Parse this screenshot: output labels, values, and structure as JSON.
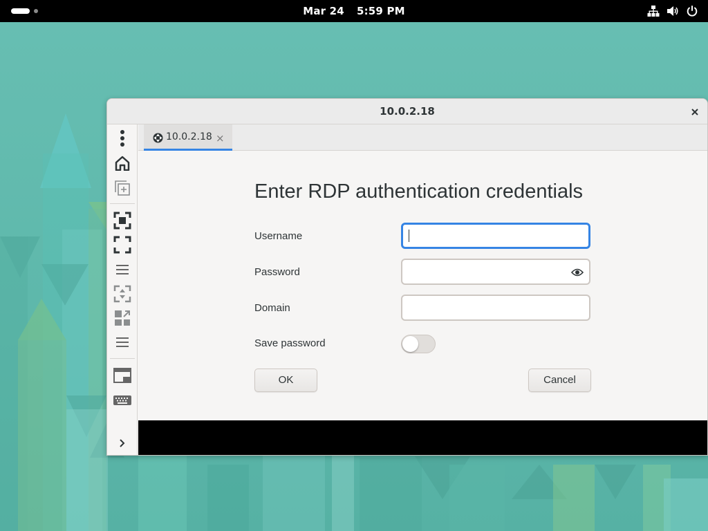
{
  "topbar": {
    "date": "Mar 24",
    "time": "5:59 PM",
    "tray_icons": [
      "network-icon",
      "volume-icon",
      "power-icon"
    ]
  },
  "window": {
    "title": "10.0.2.18",
    "tab": {
      "label": "10.0.2.18",
      "icon": "rdp-protocol-icon"
    },
    "sidebar_icons": [
      "menu-dots-icon",
      "home-icon",
      "duplicate-icon",
      "scale-icon",
      "fullscreen-icon",
      "hamburger-icon",
      "dynamic-resolution-icon",
      "fit-window-icon",
      "hamburger-icon",
      "multi-monitor-icon",
      "keyboard-icon",
      "expand-chevron-icon"
    ]
  },
  "dialog": {
    "heading": "Enter RDP authentication credentials",
    "username_label": "Username",
    "username_value": "",
    "password_label": "Password",
    "password_value": "",
    "domain_label": "Domain",
    "domain_value": "",
    "save_password_label": "Save password",
    "save_password_on": false,
    "ok_label": "OK",
    "cancel_label": "Cancel"
  },
  "colors": {
    "accent": "#3584e4",
    "wallpaper": "#5fb9ac"
  }
}
